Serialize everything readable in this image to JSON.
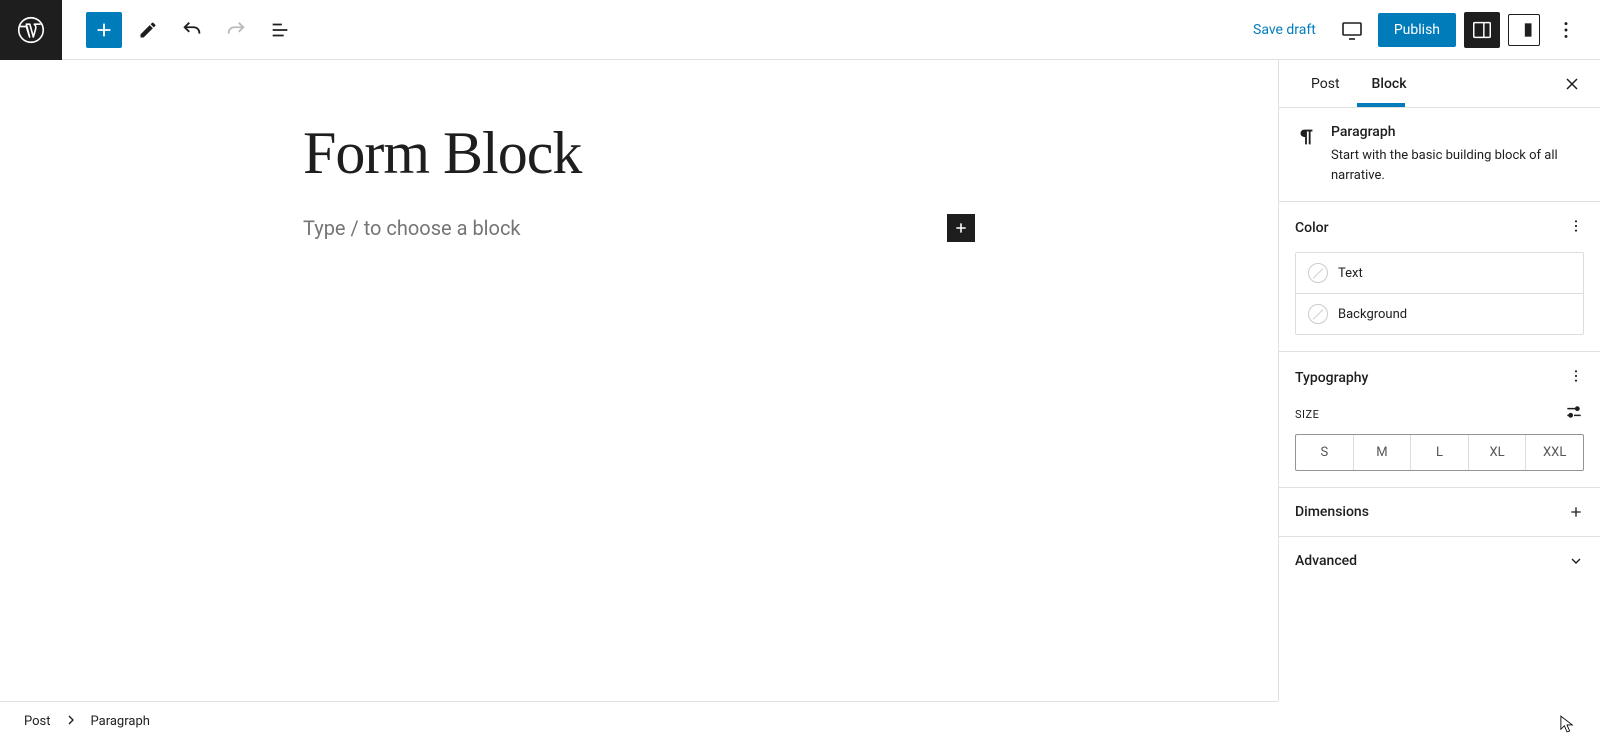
{
  "topbar": {
    "save_draft": "Save draft",
    "publish": "Publish"
  },
  "editor": {
    "title": "Form Block",
    "placeholder": "Type / to choose a block"
  },
  "sidebar": {
    "tabs": {
      "post": "Post",
      "block": "Block"
    },
    "block_info": {
      "title": "Paragraph",
      "description": "Start with the basic building block of all narrative."
    },
    "panels": {
      "color": {
        "title": "Color",
        "rows": {
          "text": "Text",
          "background": "Background"
        }
      },
      "typography": {
        "title": "Typography",
        "size_label": "SIZE",
        "sizes": [
          "S",
          "M",
          "L",
          "XL",
          "XXL"
        ]
      },
      "dimensions": {
        "title": "Dimensions"
      },
      "advanced": {
        "title": "Advanced"
      }
    }
  },
  "breadcrumb": {
    "root": "Post",
    "current": "Paragraph"
  }
}
